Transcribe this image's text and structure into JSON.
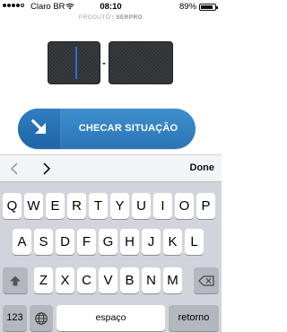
{
  "status": {
    "carrier": "Claro BR",
    "time": "08:10",
    "battery": "89%",
    "signal_bars_filled": 4,
    "signal_bars_total": 5,
    "battery_fraction": 0.89
  },
  "brand": {
    "prefix": "PRODUTO",
    "separator": "|",
    "name": "SERPRO"
  },
  "form": {
    "code_first": "",
    "code_second": "",
    "separator": "-"
  },
  "check_button": {
    "label": "CHECAR SITUAÇÃO",
    "icon": "arrow-down-right-icon",
    "color": "#3a86c8"
  },
  "accessory": {
    "prev_icon": "chevron-left-icon",
    "next_icon": "chevron-right-icon",
    "done": "Done"
  },
  "keyboard": {
    "row1": [
      "Q",
      "W",
      "E",
      "R",
      "T",
      "Y",
      "U",
      "I",
      "O",
      "P"
    ],
    "row2": [
      "A",
      "S",
      "D",
      "F",
      "G",
      "H",
      "J",
      "K",
      "L"
    ],
    "row3": [
      "Z",
      "X",
      "C",
      "V",
      "B",
      "N",
      "M"
    ],
    "shift_icon": "shift-icon",
    "delete_icon": "backspace-icon",
    "numbers": "123",
    "globe_icon": "globe-icon",
    "space": "espaço",
    "return": "retorno"
  }
}
